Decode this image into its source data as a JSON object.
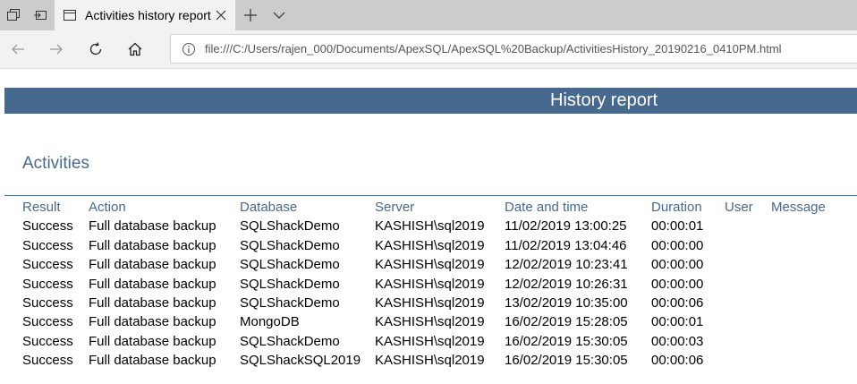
{
  "browser": {
    "tab": {
      "title": "Activities history report"
    },
    "address": {
      "url": "file:///C:/Users/rajen_000/Documents/ApexSQL/ApexSQL%20Backup/ActivitiesHistory_20190216_0410PM.html"
    },
    "icons": {
      "tabs_aside": "tabs-aside-icon",
      "set_aside": "set-aside-icon",
      "page": "page-icon",
      "close": "close-icon",
      "new_tab": "plus-icon",
      "tab_menu": "chevron-down-icon",
      "back": "arrow-left-icon",
      "forward": "arrow-right-icon",
      "refresh": "refresh-icon",
      "home": "home-icon",
      "info": "info-icon"
    }
  },
  "report": {
    "banner_title": "History report",
    "section_title": "Activities",
    "colors": {
      "accent": "#48698e"
    },
    "columns": {
      "result": "Result",
      "action": "Action",
      "database": "Database",
      "server": "Server",
      "datetime": "Date and time",
      "duration": "Duration",
      "user": "User",
      "message": "Message"
    },
    "rows": [
      {
        "result": "Success",
        "action": "Full database backup",
        "database": "SQLShackDemo",
        "server": "KASHISH\\sql2019",
        "datetime": "11/02/2019 13:00:25",
        "duration": "00:00:01",
        "user": "",
        "message": ""
      },
      {
        "result": "Success",
        "action": "Full database backup",
        "database": "SQLShackDemo",
        "server": "KASHISH\\sql2019",
        "datetime": "11/02/2019 13:04:46",
        "duration": "00:00:00",
        "user": "",
        "message": ""
      },
      {
        "result": "Success",
        "action": "Full database backup",
        "database": "SQLShackDemo",
        "server": "KASHISH\\sql2019",
        "datetime": "12/02/2019 10:23:41",
        "duration": "00:00:00",
        "user": "",
        "message": ""
      },
      {
        "result": "Success",
        "action": "Full database backup",
        "database": "SQLShackDemo",
        "server": "KASHISH\\sql2019",
        "datetime": "12/02/2019 10:26:31",
        "duration": "00:00:00",
        "user": "",
        "message": ""
      },
      {
        "result": "Success",
        "action": "Full database backup",
        "database": "SQLShackDemo",
        "server": "KASHISH\\sql2019",
        "datetime": "13/02/2019 10:35:00",
        "duration": "00:00:06",
        "user": "",
        "message": ""
      },
      {
        "result": "Success",
        "action": "Full database backup",
        "database": "MongoDB",
        "server": "KASHISH\\sql2019",
        "datetime": "16/02/2019 15:28:05",
        "duration": "00:00:01",
        "user": "",
        "message": ""
      },
      {
        "result": "Success",
        "action": "Full database backup",
        "database": "SQLShackDemo",
        "server": "KASHISH\\sql2019",
        "datetime": "16/02/2019 15:30:05",
        "duration": "00:00:03",
        "user": "",
        "message": ""
      },
      {
        "result": "Success",
        "action": "Full database backup",
        "database": "SQLShackSQL2019",
        "server": "KASHISH\\sql2019",
        "datetime": "16/02/2019 15:30:05",
        "duration": "00:00:06",
        "user": "",
        "message": ""
      }
    ]
  }
}
